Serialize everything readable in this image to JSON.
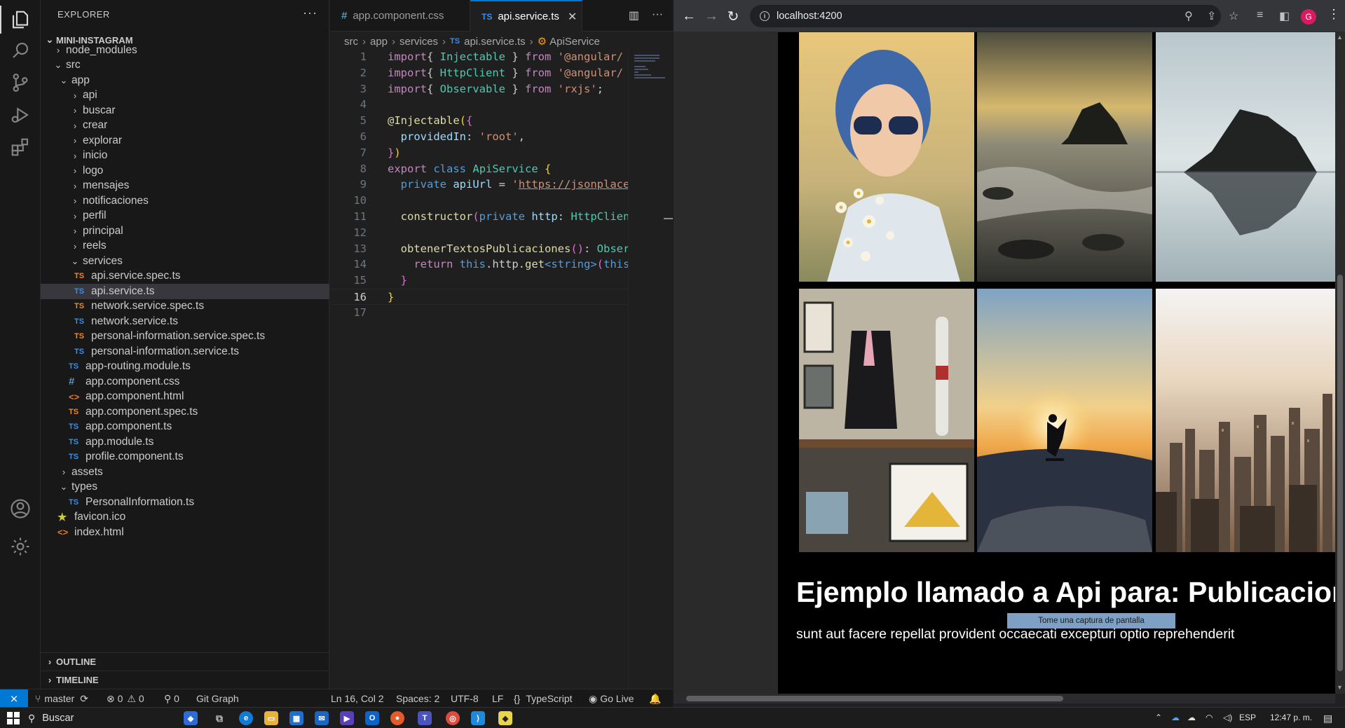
{
  "vscode": {
    "explorer_title": "EXPLORER",
    "more_glyph": "···",
    "project": "MINI-INSTAGRAM",
    "tree": [
      {
        "label": "node_modules",
        "icon": "folder",
        "depth": 2,
        "chev": "›",
        "name": "node-modules"
      },
      {
        "label": "src",
        "icon": "folder",
        "depth": 2,
        "chev": "⌄",
        "name": "src"
      },
      {
        "label": "app",
        "icon": "folder",
        "depth": 3,
        "chev": "⌄",
        "name": "app"
      },
      {
        "label": "api",
        "icon": "folder",
        "depth": 4,
        "chev": "›",
        "name": "api"
      },
      {
        "label": "buscar",
        "icon": "folder",
        "depth": 4,
        "chev": "›",
        "name": "buscar"
      },
      {
        "label": "crear",
        "icon": "folder",
        "depth": 4,
        "chev": "›",
        "name": "crear"
      },
      {
        "label": "explorar",
        "icon": "folder",
        "depth": 4,
        "chev": "›",
        "name": "explorar"
      },
      {
        "label": "inicio",
        "icon": "folder",
        "depth": 4,
        "chev": "›",
        "name": "inicio"
      },
      {
        "label": "logo",
        "icon": "folder",
        "depth": 4,
        "chev": "›",
        "name": "logo"
      },
      {
        "label": "mensajes",
        "icon": "folder",
        "depth": 4,
        "chev": "›",
        "name": "mensajes"
      },
      {
        "label": "notificaciones",
        "icon": "folder",
        "depth": 4,
        "chev": "›",
        "name": "notificaciones"
      },
      {
        "label": "perfil",
        "icon": "folder",
        "depth": 4,
        "chev": "›",
        "name": "perfil"
      },
      {
        "label": "principal",
        "icon": "folder",
        "depth": 4,
        "chev": "›",
        "name": "principal"
      },
      {
        "label": "reels",
        "icon": "folder",
        "depth": 4,
        "chev": "›",
        "name": "reels"
      },
      {
        "label": "services",
        "icon": "folder",
        "depth": 4,
        "chev": "⌄",
        "name": "services"
      },
      {
        "label": "api.service.spec.ts",
        "icon": "ts-spec",
        "depth": 5,
        "name": "api-service-spec"
      },
      {
        "label": "api.service.ts",
        "icon": "ts",
        "depth": 5,
        "name": "api-service",
        "selected": true
      },
      {
        "label": "network.service.spec.ts",
        "icon": "ts-spec",
        "depth": 5,
        "name": "network-service-spec"
      },
      {
        "label": "network.service.ts",
        "icon": "ts",
        "depth": 5,
        "name": "network-service"
      },
      {
        "label": "personal-information.service.spec.ts",
        "icon": "ts-spec",
        "depth": 5,
        "name": "personal-information-service-spec"
      },
      {
        "label": "personal-information.service.ts",
        "icon": "ts",
        "depth": 5,
        "name": "personal-information-service"
      },
      {
        "label": "app-routing.module.ts",
        "icon": "ts",
        "depth": 4,
        "name": "app-routing-module"
      },
      {
        "label": "app.component.css",
        "icon": "css",
        "depth": 4,
        "name": "app-component-css"
      },
      {
        "label": "app.component.html",
        "icon": "html",
        "depth": 4,
        "name": "app-component-html"
      },
      {
        "label": "app.component.spec.ts",
        "icon": "ts-spec",
        "depth": 4,
        "name": "app-component-spec"
      },
      {
        "label": "app.component.ts",
        "icon": "ts",
        "depth": 4,
        "name": "app-component-ts"
      },
      {
        "label": "app.module.ts",
        "icon": "ts",
        "depth": 4,
        "name": "app-module"
      },
      {
        "label": "profile.component.ts",
        "icon": "ts",
        "depth": 4,
        "name": "profile-component"
      },
      {
        "label": "assets",
        "icon": "folder",
        "depth": 3,
        "chev": "›",
        "name": "assets"
      },
      {
        "label": "types",
        "icon": "folder",
        "depth": 3,
        "chev": "⌄",
        "name": "types"
      },
      {
        "label": "PersonalInformation.ts",
        "icon": "ts",
        "depth": 4,
        "name": "personal-information-type"
      },
      {
        "label": "favicon.ico",
        "icon": "star",
        "depth": 3,
        "name": "favicon"
      },
      {
        "label": "index.html",
        "icon": "html",
        "depth": 3,
        "name": "index-html"
      }
    ],
    "outline": "OUTLINE",
    "timeline": "TIMELINE",
    "tabs": [
      {
        "label": "app.component.css",
        "icon": "#"
      },
      {
        "label": "api.service.ts",
        "icon": "TS",
        "close": "✕"
      }
    ],
    "breadcrumb": [
      "src",
      "app",
      "services",
      "api.service.ts",
      "ApiService"
    ],
    "code": [
      [
        [
          "k-kw",
          "import"
        ],
        [
          "",
          "{ "
        ],
        [
          "k-ty",
          "Injectable"
        ],
        [
          "",
          " } "
        ],
        [
          "k-kw",
          "from"
        ],
        [
          "k-st",
          " '@angular/"
        ]
      ],
      [
        [
          "k-kw",
          "import"
        ],
        [
          "",
          "{ "
        ],
        [
          "k-ty",
          "HttpClient"
        ],
        [
          "",
          " } "
        ],
        [
          "k-kw",
          "from"
        ],
        [
          "k-st",
          " '@angular/"
        ]
      ],
      [
        [
          "k-kw",
          "import"
        ],
        [
          "",
          "{ "
        ],
        [
          "k-ty",
          "Observable"
        ],
        [
          "",
          " } "
        ],
        [
          "k-kw",
          "from"
        ],
        [
          "k-st",
          " 'rxjs'"
        ],
        [
          "",
          ";"
        ]
      ],
      [],
      [
        [
          "k-fn",
          "@Injectable"
        ],
        [
          "k-br",
          "("
        ],
        [
          "k-br2",
          "{"
        ]
      ],
      [
        [
          "",
          "  "
        ],
        [
          "k-pr",
          "providedIn"
        ],
        [
          "",
          ": "
        ],
        [
          "k-st",
          "'root'"
        ],
        [
          "",
          ","
        ]
      ],
      [
        [
          "k-br2",
          "}"
        ],
        [
          "k-br",
          ")"
        ]
      ],
      [
        [
          "k-kw",
          "export"
        ],
        [
          "",
          " "
        ],
        [
          "k-bl",
          "class"
        ],
        [
          "",
          " "
        ],
        [
          "k-ty",
          "ApiService"
        ],
        [
          "",
          " "
        ],
        [
          "k-br",
          "{"
        ]
      ],
      [
        [
          "",
          "  "
        ],
        [
          "k-bl",
          "private"
        ],
        [
          "",
          " "
        ],
        [
          "k-pr",
          "apiUrl"
        ],
        [
          "",
          " = "
        ],
        [
          "k-st",
          "'"
        ],
        [
          "k-url",
          "https://jsonplace"
        ]
      ],
      [],
      [
        [
          "",
          "  "
        ],
        [
          "k-fn",
          "constructor"
        ],
        [
          "k-br2",
          "("
        ],
        [
          "k-bl",
          "private"
        ],
        [
          "",
          " "
        ],
        [
          "k-pr",
          "http"
        ],
        [
          "",
          ": "
        ],
        [
          "k-ty",
          "HttpClien"
        ]
      ],
      [],
      [
        [
          "",
          "  "
        ],
        [
          "k-fn",
          "obtenerTextosPublicaciones"
        ],
        [
          "k-br2",
          "()"
        ],
        [
          "",
          ": "
        ],
        [
          "k-ty",
          "Obser"
        ]
      ],
      [
        [
          "",
          "    "
        ],
        [
          "k-kw",
          "return"
        ],
        [
          "",
          " "
        ],
        [
          "k-bl",
          "this"
        ],
        [
          "",
          ".http."
        ],
        [
          "k-fn",
          "get"
        ],
        [
          "k-bl",
          "<string>"
        ],
        [
          "k-br2",
          "("
        ],
        [
          "k-bl",
          "this"
        ]
      ],
      [
        [
          "",
          "  "
        ],
        [
          "k-br2",
          "}"
        ]
      ],
      [
        [
          "k-br",
          "}"
        ]
      ],
      []
    ],
    "current_line": 16,
    "status": {
      "remote": "⨯",
      "branch": "master",
      "sync": "⟳",
      "errors": "⊗ 0",
      "warnings": "⚠ 0",
      "ports": "⚲ 0",
      "git_graph": "Git Graph",
      "cursor": "Ln 16, Col 2",
      "spaces": "Spaces: 2",
      "encoding": "UTF-8",
      "eol": "LF",
      "language_icon": "{}",
      "language": "TypeScript",
      "go_live": "Go Live",
      "bell": "🔔"
    }
  },
  "browser": {
    "url": "localhost:4200",
    "heading": "Ejemplo llamado a Api para: Publicacion",
    "paragraph": "sunt aut facere repellat provident occaecati excepturi optio reprehenderit",
    "tooltip": "Tome una captura de pantalla",
    "avatar_letter": "G",
    "photos": [
      {
        "name": "photo-woman-sunglasses"
      },
      {
        "name": "photo-beach-rocks-waves"
      },
      {
        "name": "photo-rock-reflection"
      },
      {
        "name": "photo-shop-interior"
      },
      {
        "name": "photo-skateboarder-sunset"
      },
      {
        "name": "photo-city-skyline"
      }
    ]
  },
  "taskbar": {
    "search": "Buscar",
    "lang": "ESP",
    "time": "12:47 p. m."
  },
  "colors": {
    "accent": "#0078d4",
    "editor_bg": "#1f1f1f",
    "sidebar_bg": "#181818"
  }
}
